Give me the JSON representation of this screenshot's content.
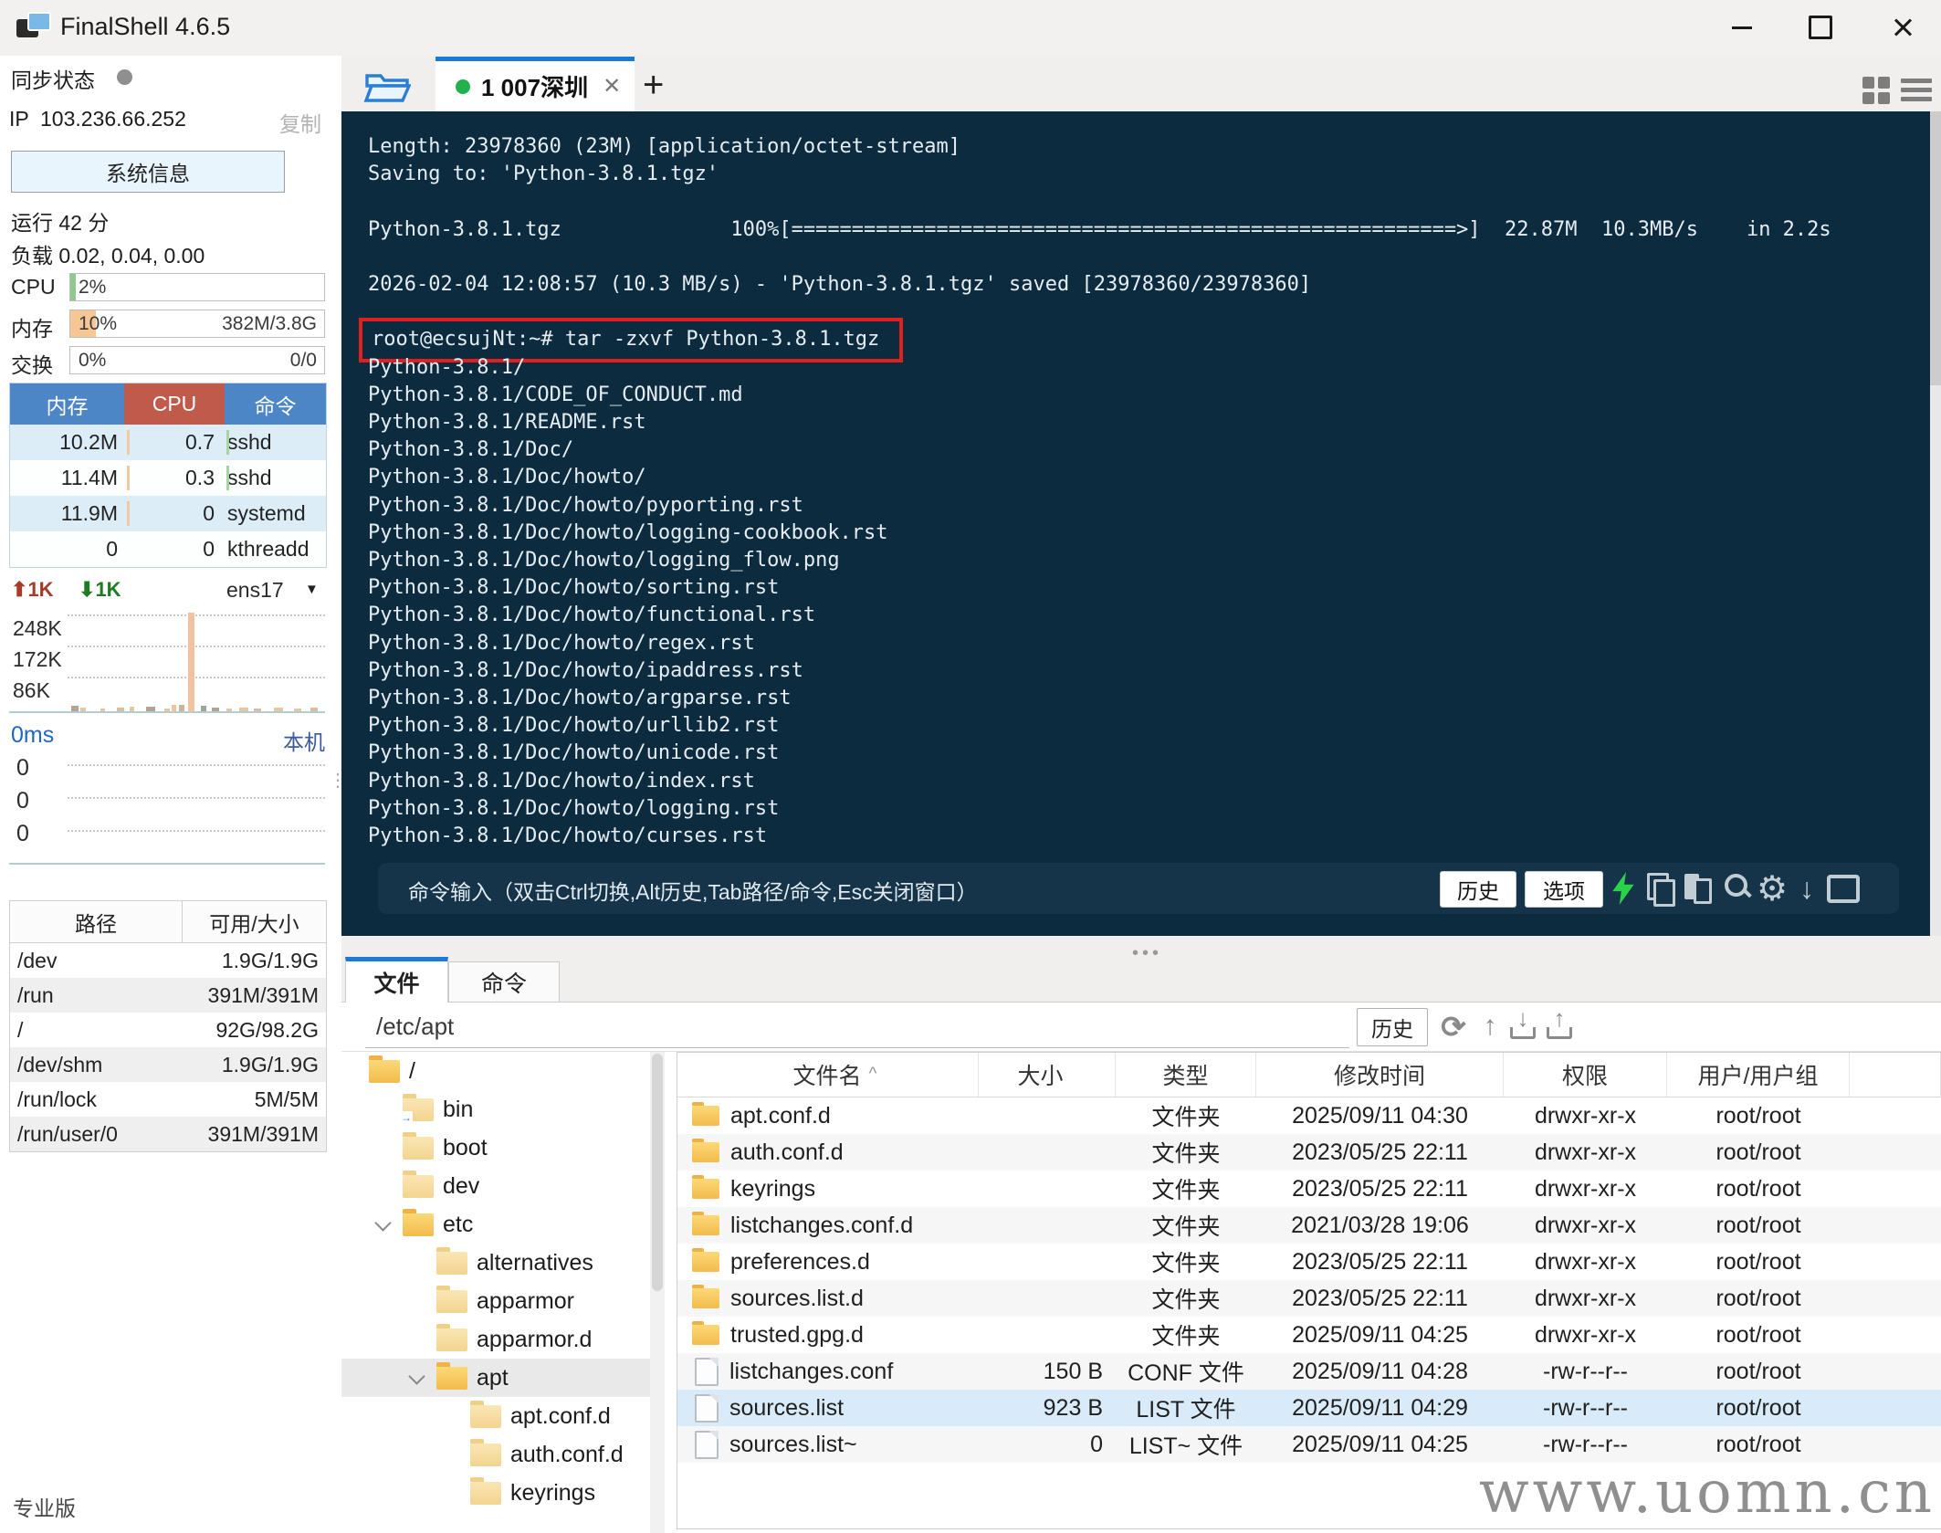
{
  "window": {
    "title": "FinalShell 4.6.5"
  },
  "sidebar": {
    "sync_label": "同步状态",
    "ip_label": "IP",
    "ip": "103.236.66.252",
    "copy_label": "复制",
    "sysinfo_button": "系统信息",
    "uptime": "运行 42 分",
    "load": "负载 0.02, 0.04, 0.00",
    "cpu": {
      "label": "CPU",
      "value": "2%",
      "percent": 2,
      "detail": ""
    },
    "mem": {
      "label": "内存",
      "value": "10%",
      "percent": 10,
      "detail": "382M/3.8G"
    },
    "swap": {
      "label": "交换",
      "value": "0%",
      "percent": 0,
      "detail": "0/0"
    },
    "process_table": {
      "headers": [
        "内存",
        "CPU",
        "命令"
      ],
      "rows": [
        [
          "10.2M",
          "0.7",
          "sshd"
        ],
        [
          "11.4M",
          "0.3",
          "sshd"
        ],
        [
          "11.9M",
          "0",
          "systemd"
        ],
        [
          "0",
          "0",
          "kthreadd"
        ]
      ]
    },
    "network": {
      "up": "1K",
      "down": "1K",
      "iface": "ens17",
      "scale": [
        "248K",
        "172K",
        "86K"
      ]
    },
    "ping": {
      "latency": "0ms",
      "host": "本机",
      "scale": [
        "0",
        "0",
        "0"
      ]
    },
    "disk_table": {
      "headers": [
        "路径",
        "可用/大小"
      ],
      "rows": [
        [
          "/dev",
          "1.9G/1.9G"
        ],
        [
          "/run",
          "391M/391M"
        ],
        [
          "/",
          "92G/98.2G"
        ],
        [
          "/dev/shm",
          "1.9G/1.9G"
        ],
        [
          "/run/lock",
          "5M/5M"
        ],
        [
          "/run/user/0",
          "391M/391M"
        ]
      ]
    },
    "edition": "专业版"
  },
  "tabs": {
    "active_tab": "1 007深圳",
    "new_tab_icon": "+",
    "close_icon": "✕"
  },
  "terminal": {
    "lines": [
      "Length: 23978360 (23M) [application/octet-stream]",
      "Saving to: 'Python-3.8.1.tgz'",
      "",
      "Python-3.8.1.tgz              100%[=======================================================>]  22.87M  10.3MB/s    in 2.2s",
      "",
      "2026-02-04 12:08:57 (10.3 MB/s) - 'Python-3.8.1.tgz' saved [23978360/23978360]",
      "",
      "root@ecsujNt:~# tar -zxvf Python-3.8.1.tgz",
      "Python-3.8.1/",
      "Python-3.8.1/CODE_OF_CONDUCT.md",
      "Python-3.8.1/README.rst",
      "Python-3.8.1/Doc/",
      "Python-3.8.1/Doc/howto/",
      "Python-3.8.1/Doc/howto/pyporting.rst",
      "Python-3.8.1/Doc/howto/logging-cookbook.rst",
      "Python-3.8.1/Doc/howto/logging_flow.png",
      "Python-3.8.1/Doc/howto/sorting.rst",
      "Python-3.8.1/Doc/howto/functional.rst",
      "Python-3.8.1/Doc/howto/regex.rst",
      "Python-3.8.1/Doc/howto/ipaddress.rst",
      "Python-3.8.1/Doc/howto/argparse.rst",
      "Python-3.8.1/Doc/howto/urllib2.rst",
      "Python-3.8.1/Doc/howto/unicode.rst",
      "Python-3.8.1/Doc/howto/index.rst",
      "Python-3.8.1/Doc/howto/logging.rst",
      "Python-3.8.1/Doc/howto/curses.rst"
    ],
    "highlight_index": 7,
    "input_placeholder": "命令输入（双击Ctrl切换,Alt历史,Tab路径/命令,Esc关闭窗口）",
    "history_button": "历史",
    "options_button": "选项",
    "toolbar_icons": [
      "lightning",
      "copy",
      "paste",
      "search",
      "settings",
      "download",
      "window"
    ]
  },
  "file_panel": {
    "tabs": [
      {
        "label": "文件"
      },
      {
        "label": "命令"
      }
    ],
    "path": "/etc/apt",
    "history_button": "历史",
    "toolbar_icons": [
      "refresh",
      "parent-dir",
      "download",
      "upload"
    ],
    "tree": [
      {
        "name": "/",
        "level": 0,
        "type": "folder",
        "expanded": false,
        "selected": false
      },
      {
        "name": "bin",
        "level": 1,
        "type": "folder-link",
        "expanded": false,
        "selected": false
      },
      {
        "name": "boot",
        "level": 1,
        "type": "folder",
        "expanded": false,
        "selected": false
      },
      {
        "name": "dev",
        "level": 1,
        "type": "folder",
        "expanded": false,
        "selected": false
      },
      {
        "name": "etc",
        "level": 1,
        "type": "folder",
        "expanded": true,
        "selected": false
      },
      {
        "name": "alternatives",
        "level": 2,
        "type": "folder",
        "expanded": false,
        "selected": false
      },
      {
        "name": "apparmor",
        "level": 2,
        "type": "folder",
        "expanded": false,
        "selected": false
      },
      {
        "name": "apparmor.d",
        "level": 2,
        "type": "folder",
        "expanded": false,
        "selected": false
      },
      {
        "name": "apt",
        "level": 2,
        "type": "folder",
        "expanded": true,
        "selected": true
      },
      {
        "name": "apt.conf.d",
        "level": 3,
        "type": "folder",
        "expanded": false,
        "selected": false
      },
      {
        "name": "auth.conf.d",
        "level": 3,
        "type": "folder",
        "expanded": false,
        "selected": false
      },
      {
        "name": "keyrings",
        "level": 3,
        "type": "folder",
        "expanded": false,
        "selected": false
      }
    ],
    "table": {
      "headers": [
        "文件名",
        "大小",
        "类型",
        "修改时间",
        "权限",
        "用户/用户组"
      ],
      "sort_indicator": "^",
      "rows": [
        {
          "name": "apt.conf.d",
          "size": "",
          "type": "文件夹",
          "mtime": "2025/09/11 04:30",
          "perm": "drwxr-xr-x",
          "owner": "root/root",
          "icon": "folder",
          "selected": false
        },
        {
          "name": "auth.conf.d",
          "size": "",
          "type": "文件夹",
          "mtime": "2023/05/25 22:11",
          "perm": "drwxr-xr-x",
          "owner": "root/root",
          "icon": "folder",
          "selected": false
        },
        {
          "name": "keyrings",
          "size": "",
          "type": "文件夹",
          "mtime": "2023/05/25 22:11",
          "perm": "drwxr-xr-x",
          "owner": "root/root",
          "icon": "folder",
          "selected": false
        },
        {
          "name": "listchanges.conf.d",
          "size": "",
          "type": "文件夹",
          "mtime": "2021/03/28 19:06",
          "perm": "drwxr-xr-x",
          "owner": "root/root",
          "icon": "folder",
          "selected": false
        },
        {
          "name": "preferences.d",
          "size": "",
          "type": "文件夹",
          "mtime": "2023/05/25 22:11",
          "perm": "drwxr-xr-x",
          "owner": "root/root",
          "icon": "folder",
          "selected": false
        },
        {
          "name": "sources.list.d",
          "size": "",
          "type": "文件夹",
          "mtime": "2023/05/25 22:11",
          "perm": "drwxr-xr-x",
          "owner": "root/root",
          "icon": "folder",
          "selected": false
        },
        {
          "name": "trusted.gpg.d",
          "size": "",
          "type": "文件夹",
          "mtime": "2025/09/11 04:25",
          "perm": "drwxr-xr-x",
          "owner": "root/root",
          "icon": "folder",
          "selected": false
        },
        {
          "name": "listchanges.conf",
          "size": "150 B",
          "type": "CONF 文件",
          "mtime": "2025/09/11 04:28",
          "perm": "-rw-r--r--",
          "owner": "root/root",
          "icon": "file",
          "selected": false
        },
        {
          "name": "sources.list",
          "size": "923 B",
          "type": "LIST 文件",
          "mtime": "2025/09/11 04:29",
          "perm": "-rw-r--r--",
          "owner": "root/root",
          "icon": "file",
          "selected": true
        },
        {
          "name": "sources.list~",
          "size": "0",
          "type": "LIST~ 文件",
          "mtime": "2025/09/11 04:25",
          "perm": "-rw-r--r--",
          "owner": "root/root",
          "icon": "file",
          "selected": false
        }
      ]
    }
  },
  "watermark": "www.uomn.cn",
  "colors": {
    "accent_blue": "#1d79d6",
    "terminal_bg": "#0d2b3f",
    "highlight_red": "#e01f1f",
    "proc_header_blue": "#4c86c7",
    "proc_header_red": "#c05a4a",
    "tab_green_dot": "#22b14c",
    "lightning_green": "#2bd148"
  }
}
